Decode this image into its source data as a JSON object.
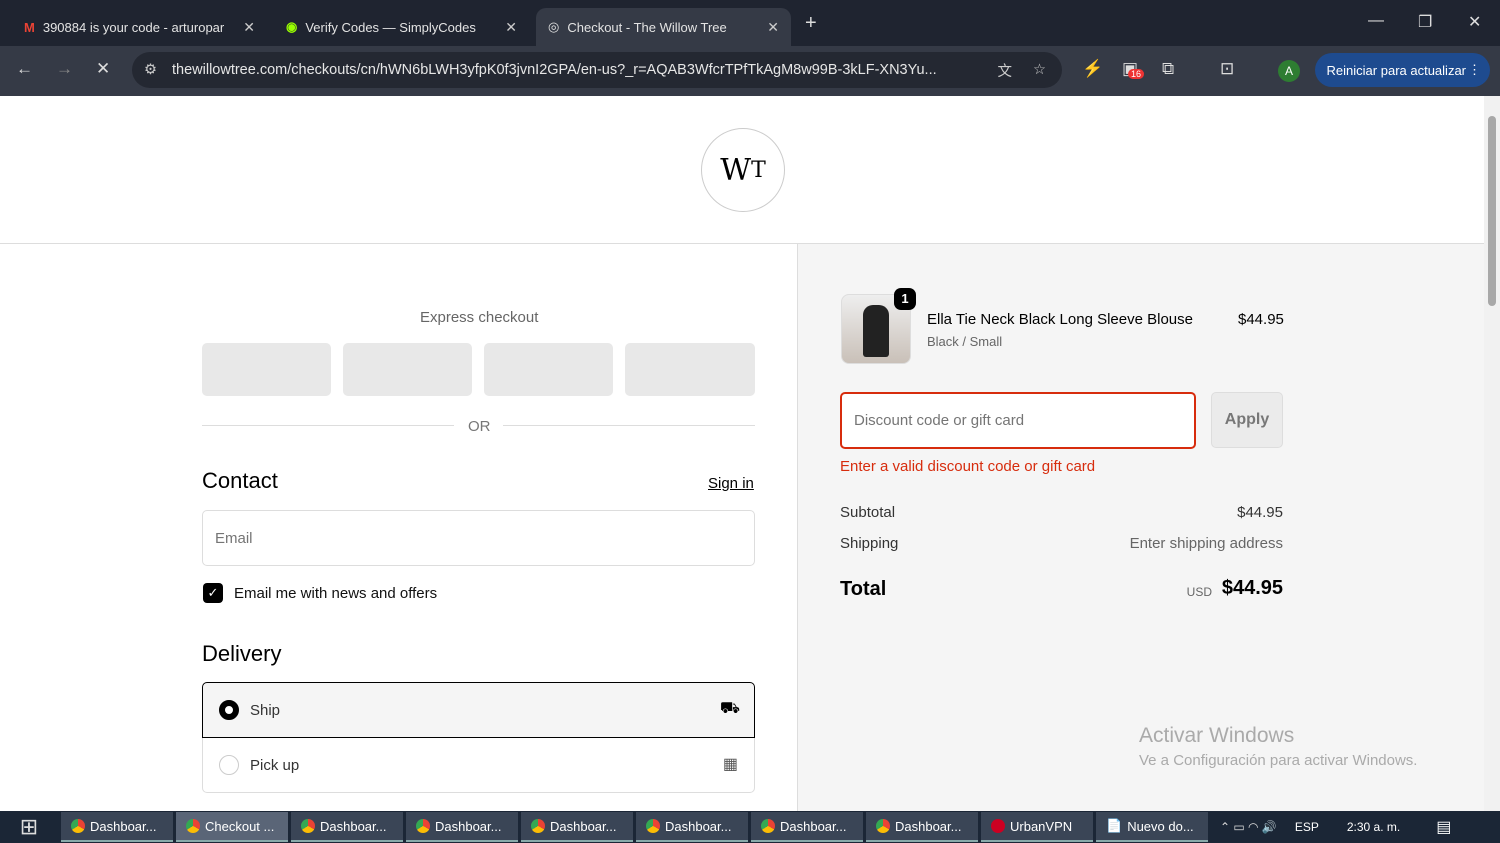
{
  "browser": {
    "tabs": [
      {
        "title": "390884 is your code - arturopar"
      },
      {
        "title": "Verify Codes — SimplyCodes"
      },
      {
        "title": "Checkout - The Willow Tree"
      }
    ],
    "url": "thewillowtree.com/checkouts/cn/hWN6bLWH3yfpK0f3jvnI2GPA/en-us?_r=AQAB3WfcrTPfTkAgM8w99B-3kLF-XN3Yu...",
    "extension_badge": "16",
    "profile_initial": "A",
    "update_label": "Reiniciar para actualizar"
  },
  "logo": "WT",
  "express": {
    "title": "Express checkout",
    "or": "OR"
  },
  "contact": {
    "heading": "Contact",
    "sign_in": "Sign in",
    "email_placeholder": "Email",
    "newsletter": "Email me with news and offers"
  },
  "delivery": {
    "heading": "Delivery",
    "options": [
      {
        "label": "Ship"
      },
      {
        "label": "Pick up"
      }
    ]
  },
  "summary": {
    "item": {
      "name": "Ella Tie Neck Black Long Sleeve Blouse",
      "variant": "Black / Small",
      "price": "$44.95",
      "qty": "1"
    },
    "discount_placeholder": "Discount code or gift card",
    "apply": "Apply",
    "error": "Enter a valid discount code or gift card",
    "subtotal_label": "Subtotal",
    "subtotal": "$44.95",
    "shipping_label": "Shipping",
    "shipping": "Enter shipping address",
    "total_label": "Total",
    "currency": "USD",
    "total": "$44.95"
  },
  "watermark": {
    "title": "Activar Windows",
    "sub": "Ve a Configuración para activar Windows."
  },
  "taskbar": {
    "items": [
      "Dashboar...",
      "Checkout ...",
      "Dashboar...",
      "Dashboar...",
      "Dashboar...",
      "Dashboar...",
      "Dashboar...",
      "Dashboar...",
      "UrbanVPN",
      "Nuevo do..."
    ],
    "lang": "ESP",
    "time": "2:30 a. m."
  },
  "colors": {
    "error": "#d72c0d",
    "update": "#1e4b8f"
  }
}
